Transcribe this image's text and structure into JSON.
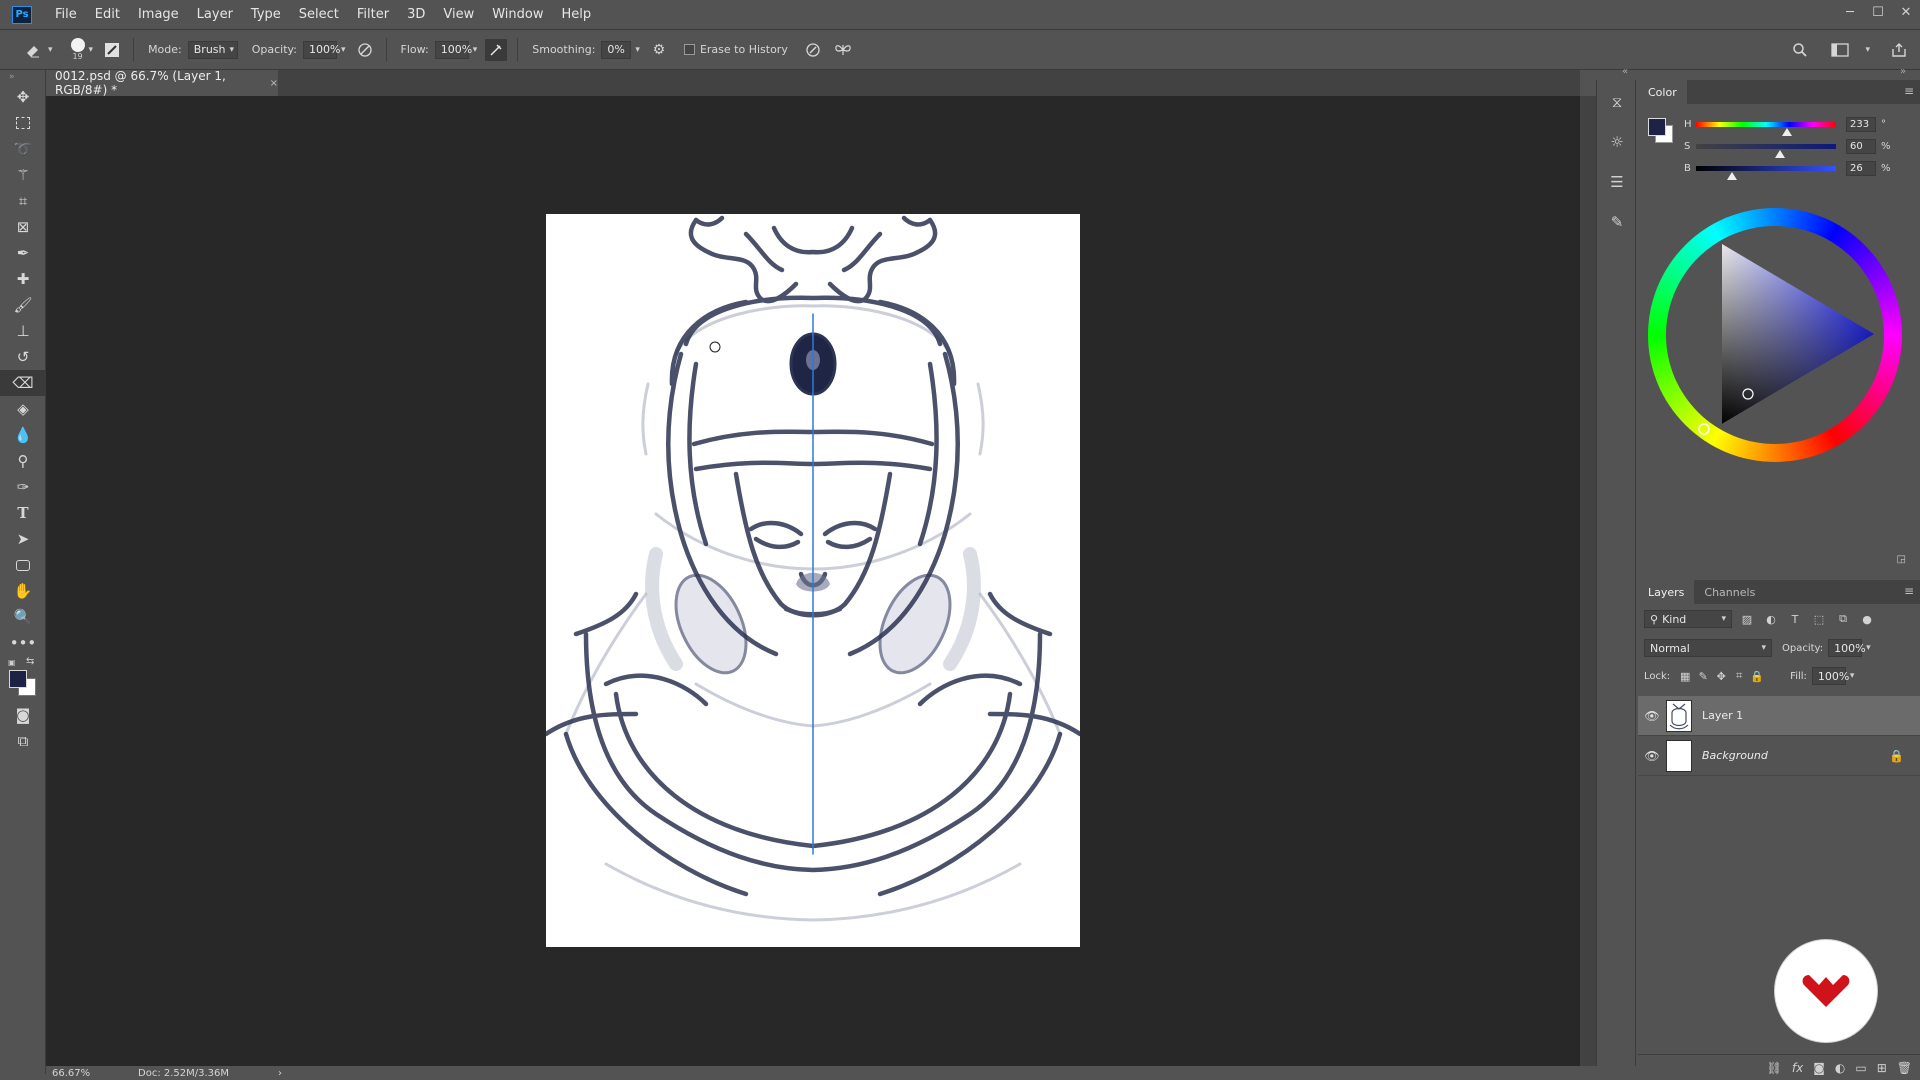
{
  "app": {
    "logo_text": "Ps",
    "menus": [
      "File",
      "Edit",
      "Image",
      "Layer",
      "Type",
      "Select",
      "Filter",
      "3D",
      "View",
      "Window",
      "Help"
    ],
    "window_controls": [
      "─",
      "☐",
      "✕"
    ]
  },
  "options": {
    "brush_size": "19",
    "mode_label": "Mode:",
    "mode_value": "Brush",
    "opacity_label": "Opacity:",
    "opacity_value": "100%",
    "flow_label": "Flow:",
    "flow_value": "100%",
    "smoothing_label": "Smoothing:",
    "smoothing_value": "0%",
    "erase_history_label": "Erase to History",
    "erase_history_checked": false
  },
  "document": {
    "tab_title": "0012.psd @ 66.7% (Layer 1, RGB/8#) *",
    "tab_close": "×"
  },
  "status": {
    "zoom": "66.67%",
    "doc_size": "Doc: 2.52M/3.36M",
    "arrow": "›"
  },
  "tools": [
    "move-icon",
    "marquee-icon",
    "lasso-icon",
    "magic-wand-icon",
    "crop-icon",
    "frame-icon",
    "eyedropper-icon",
    "healing-brush-icon",
    "brush-icon",
    "clone-stamp-icon",
    "history-brush-icon",
    "eraser-icon",
    "paint-bucket-icon",
    "blur-icon",
    "dodge-icon",
    "pen-icon",
    "type-icon",
    "path-selection-icon",
    "shape-icon",
    "hand-icon",
    "zoom-icon",
    "more-tools-icon"
  ],
  "color_panel": {
    "tab_label": "Color",
    "foreground_color": "#1e2346",
    "background_color": "#ffffff",
    "hue_label": "H",
    "hue_value": "233",
    "hue_unit": "°",
    "hue_fraction": 0.647,
    "sat_label": "S",
    "sat_value": "60",
    "sat_unit": "%",
    "sat_fraction": 0.6,
    "bri_label": "B",
    "bri_value": "26",
    "bri_unit": "%",
    "bri_fraction": 0.26
  },
  "layers_panel": {
    "tab_layers": "Layers",
    "tab_channels": "Channels",
    "filter_kind": "Kind",
    "blend_mode": "Normal",
    "opacity_label": "Opacity:",
    "opacity_value": "100%",
    "lock_label": "Lock:",
    "fill_label": "Fill:",
    "fill_value": "100%",
    "layers": [
      {
        "name": "Layer 1",
        "visible": true,
        "selected": true
      },
      {
        "name": "Background",
        "visible": true,
        "locked": true
      }
    ]
  },
  "colors": {
    "ui_bg": "#535353",
    "canvas_bg": "#282828",
    "sketch_stroke": "#2d3352",
    "guide_line": "#2b7bd6",
    "badge_red": "#d0121b"
  }
}
